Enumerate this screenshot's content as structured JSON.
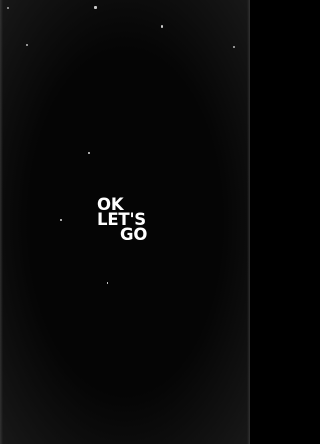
{
  "screen": {
    "background_color": "#050505",
    "text_color": "#ffffff"
  },
  "headline": {
    "line1": "OK",
    "line2": "LET'S",
    "line3": "GO"
  }
}
